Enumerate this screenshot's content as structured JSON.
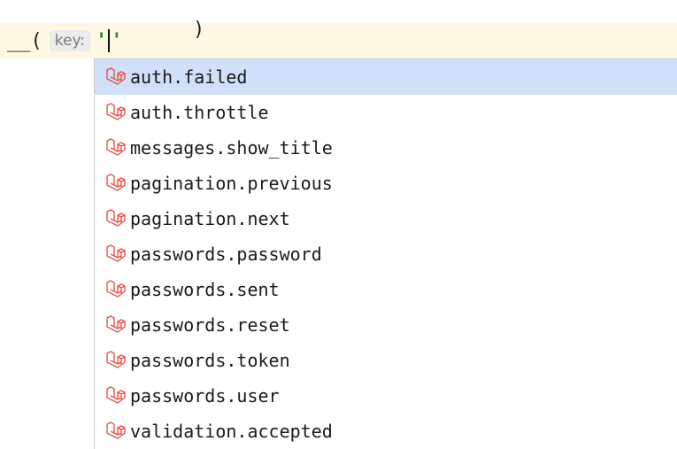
{
  "editor": {
    "prefix": "__(",
    "param_hint": "key:",
    "quote_open": "'",
    "quote_close": "'",
    "close_paren": ")"
  },
  "completion": {
    "icon": "laravel-icon",
    "accent_color": "#e8534a",
    "selected_index": 0,
    "items": [
      {
        "label": "auth.failed"
      },
      {
        "label": "auth.throttle"
      },
      {
        "label": "messages.show_title"
      },
      {
        "label": "pagination.previous"
      },
      {
        "label": "pagination.next"
      },
      {
        "label": "passwords.password"
      },
      {
        "label": "passwords.sent"
      },
      {
        "label": "passwords.reset"
      },
      {
        "label": "passwords.token"
      },
      {
        "label": "passwords.user"
      },
      {
        "label": "validation.accepted"
      }
    ]
  }
}
